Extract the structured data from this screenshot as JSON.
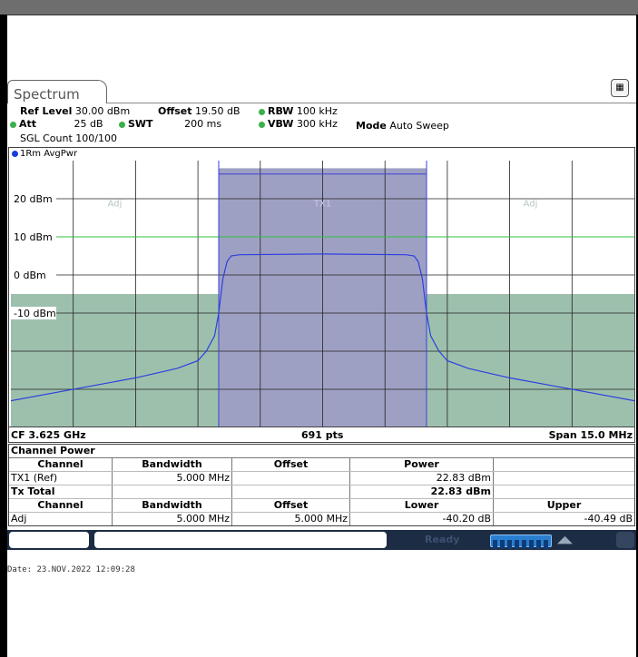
{
  "tab_label": "Spectrum",
  "settings": {
    "ref_level_label": "Ref Level",
    "ref_level_value": "30.00 dBm",
    "offset_label": "Offset",
    "offset_value": "19.50 dB",
    "rbw_label": "RBW",
    "rbw_value": "100 kHz",
    "att_label": "Att",
    "att_value": "25 dB",
    "swt_label": "SWT",
    "swt_value": "200 ms",
    "vbw_label": "VBW",
    "vbw_value": "300 kHz",
    "mode_label": "Mode",
    "mode_value": "Auto Sweep",
    "sgl_count": "SGL Count 100/100"
  },
  "trace_label": "1Rm AvgPwr",
  "chart_data": {
    "type": "line",
    "y_ticks": [
      "20 dBm",
      "10 dBm",
      "0 dBm",
      "-10 dBm"
    ],
    "ylim": [
      -40,
      30
    ],
    "xlim_mhz": [
      -7.5,
      7.5
    ],
    "channel_labels": [
      "Adj",
      "TX1",
      "Adj"
    ],
    "tx_channel_mhz": [
      -2.5,
      2.5
    ],
    "adj_channel_bw_mhz": 5.0,
    "limit_line_dbm": 10,
    "series": [
      {
        "x": [
          -7.5,
          -6.5,
          -5.5,
          -4.5,
          -3.5,
          -3.0,
          -2.8,
          -2.6,
          -2.5,
          -2.4,
          -2.3,
          -2.2,
          -2.0,
          0,
          2.0,
          2.2,
          2.3,
          2.4,
          2.5,
          2.6,
          2.8,
          3.0,
          3.5,
          4.5,
          5.5,
          6.5,
          7.5
        ],
        "y": [
          -33,
          -31,
          -29,
          -27,
          -24.5,
          -22.5,
          -20,
          -16,
          -10,
          -1,
          3.5,
          5,
          5.3,
          5.5,
          5.3,
          5,
          3.5,
          -1,
          -10,
          -16,
          -20,
          -22.5,
          -24.5,
          -27,
          -29,
          -31,
          -33
        ]
      }
    ],
    "colors": {
      "trace": "#2d3fe0",
      "tx_fill": "#9ea0c3",
      "adj_fill": "#9dc0ad",
      "limit_line": "#2fbf3f",
      "channel_border": "#3a43d8"
    }
  },
  "plot_footer": {
    "center": "CF 3.625 GHz",
    "points": "691 pts",
    "span": "Span 15.0 MHz"
  },
  "table": {
    "title": "Channel Power",
    "header1": [
      "Channel",
      "Bandwidth",
      "Offset",
      "Power",
      ""
    ],
    "row_tx": [
      "TX1 (Ref)",
      "5.000 MHz",
      "",
      "22.83 dBm",
      ""
    ],
    "row_total": [
      "Tx Total",
      "",
      "",
      "22.83 dBm",
      ""
    ],
    "header2": [
      "Channel",
      "Bandwidth",
      "Offset",
      "Lower",
      "Upper"
    ],
    "row_adj": [
      "Adj",
      "5.000 MHz",
      "5.000 MHz",
      "-40.20 dB",
      "-40.49 dB"
    ]
  },
  "status": {
    "ready": "Ready"
  },
  "date_line": "Date: 23.NOV.2022  12:09:28"
}
